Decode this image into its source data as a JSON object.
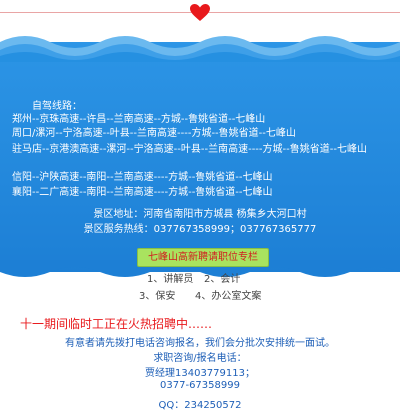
{
  "colors": {
    "ocean": "#2590e1",
    "heart": "#e8191c",
    "headline": "#e8191c",
    "contact_text": "#1e5fb7",
    "job_header_bg": "#a9e35f"
  },
  "icons": [
    "heart-icon"
  ],
  "route": {
    "title": "自驾线路：",
    "lines": [
      "郑州--京珠高速--许昌--兰南高速--方城--鲁姚省道--七峰山",
      "周口/漯河--宁洛高速--叶县--兰南高速----方城--鲁姚省道--七峰山",
      "驻马店--京港澳高速--漯河--宁洛高速--叶县--兰南高速----方城--鲁姚省道--七峰山",
      "信阳--沪陕高速--南阳--兰南高速----方城--鲁姚省道--七峰山",
      "襄阳--二广高速--南阳--兰南高速----方城--鲁姚省道--七峰山"
    ]
  },
  "scenic": {
    "address": "景区地址：河南省南阳市方城县 杨集乡大河口村",
    "hotline": "景区服务热线：037767358999；037767365777"
  },
  "jobs": {
    "header": "七峰山高新聘请职位专栏",
    "positions": [
      "1、讲解员",
      "2、会计",
      "3、保安",
      "4、办公室文案"
    ]
  },
  "recruit": {
    "headline": "十一期间临时工正在火热招聘中……",
    "notice": "有意者请先拨打电话咨询报名，我们会分批次安排统一面试。",
    "contact_label": "求职咨询/报名电话：",
    "manager": "贾经理13403779113；",
    "phone": "0377-67358999",
    "qq": "QQ：234250572"
  }
}
